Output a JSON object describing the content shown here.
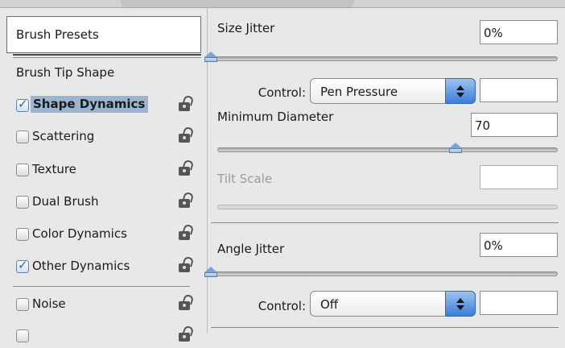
{
  "left_panel": {
    "brush_presets": "Brush Presets",
    "brush_tip_shape": "Brush Tip Shape",
    "items": [
      {
        "label": "Shape Dynamics",
        "checked": true,
        "selected": true,
        "icon": "lock-icon"
      },
      {
        "label": "Scattering",
        "checked": false,
        "selected": false,
        "icon": "lock-icon"
      },
      {
        "label": "Texture",
        "checked": false,
        "selected": false,
        "icon": "lock-icon"
      },
      {
        "label": "Dual Brush",
        "checked": false,
        "selected": false,
        "icon": "lock-icon"
      },
      {
        "label": "Color Dynamics",
        "checked": false,
        "selected": false,
        "icon": "lock-icon"
      },
      {
        "label": "Other Dynamics",
        "checked": true,
        "selected": false,
        "icon": "lock-icon"
      },
      {
        "label": "Noise",
        "checked": false,
        "selected": false,
        "icon": "lock-icon"
      }
    ]
  },
  "right_panel": {
    "size_jitter": {
      "label": "Size Jitter",
      "value": "0%",
      "slider_fraction": 0.0
    },
    "control_1": {
      "label": "Control:",
      "selected": "Pen Pressure",
      "value": ""
    },
    "minimum_diameter": {
      "label": "Minimum Diameter",
      "value": "70",
      "slider_fraction": 0.7
    },
    "tilt_scale": {
      "label": "Tilt Scale",
      "value": "",
      "disabled": true
    },
    "angle_jitter": {
      "label": "Angle Jitter",
      "value": "0%",
      "slider_fraction": 0.0
    },
    "control_2": {
      "label": "Control:",
      "selected": "Off",
      "value": ""
    }
  },
  "colors": {
    "selection": "#9bb4cf",
    "check": "#2b66b8",
    "stepper": "#3b7dd8"
  }
}
